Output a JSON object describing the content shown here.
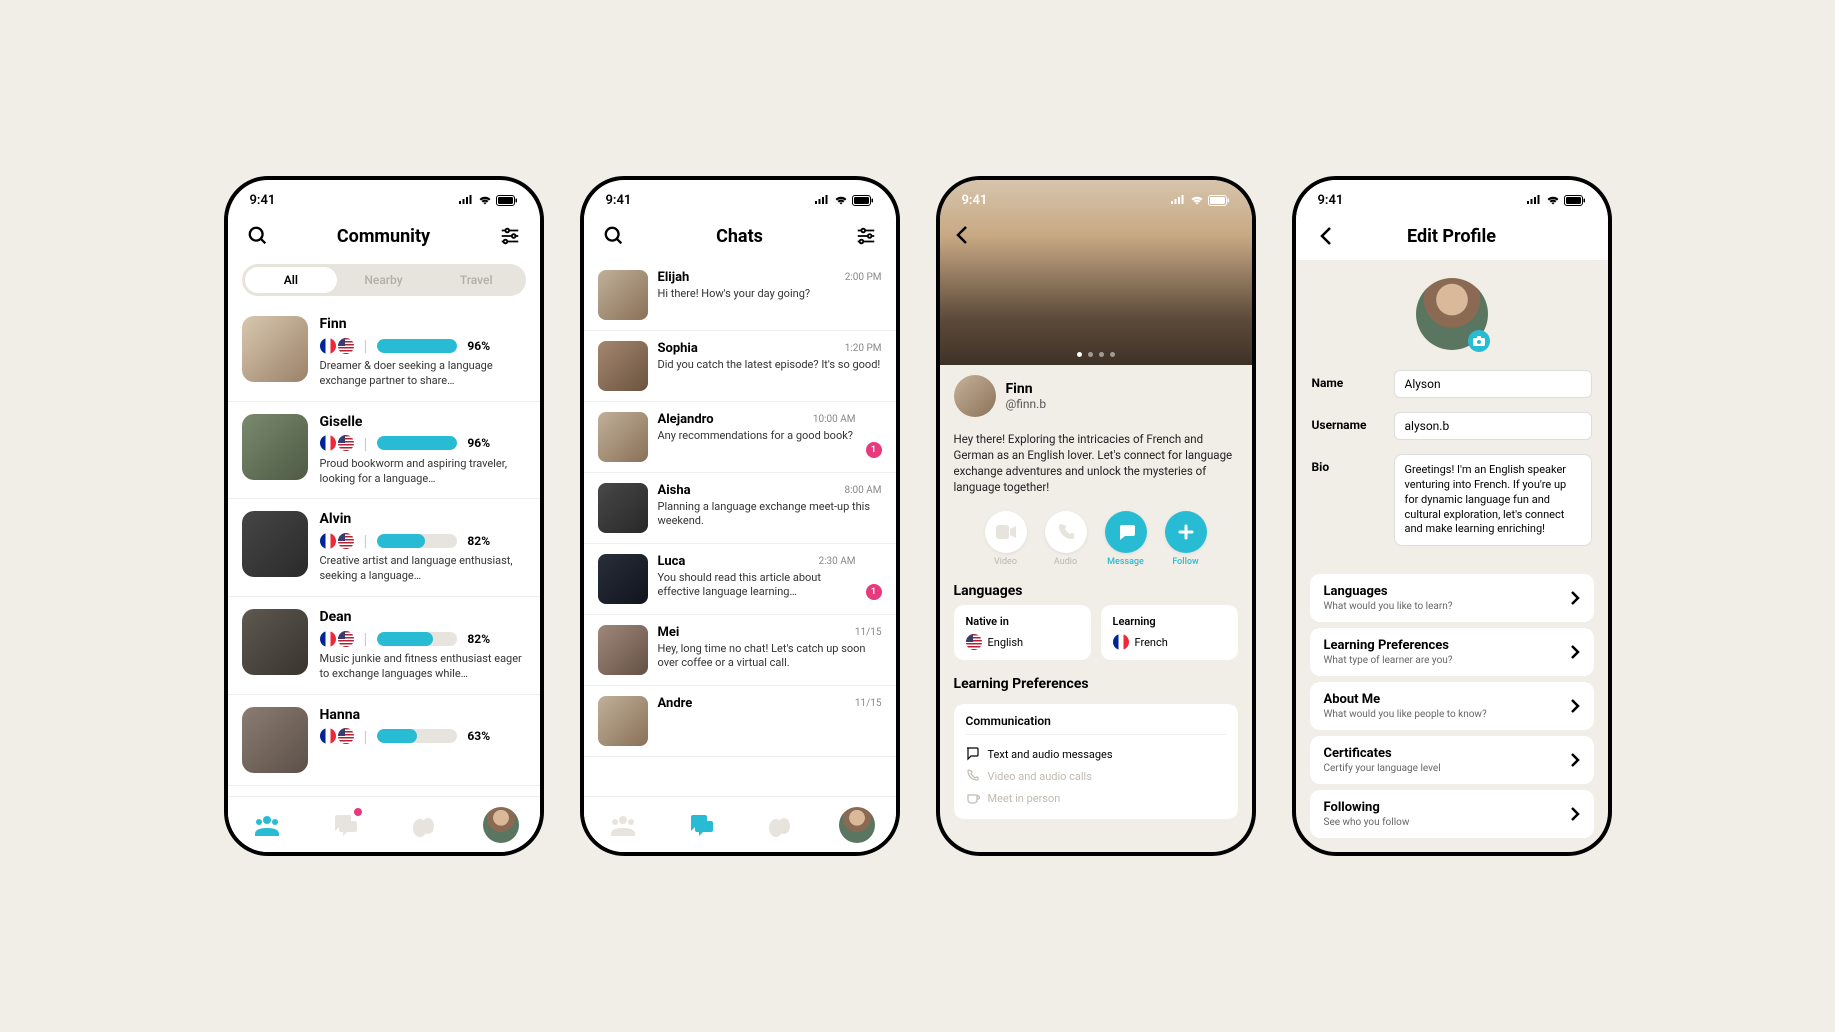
{
  "statusBar": {
    "time": "9:41"
  },
  "screen1": {
    "title": "Community",
    "tabs": [
      "All",
      "Nearby",
      "Travel"
    ],
    "activeTab": 0,
    "users": [
      {
        "name": "Finn",
        "percent": 96,
        "fill": 100,
        "bio": "Dreamer & doer seeking a language exchange partner to share…"
      },
      {
        "name": "Giselle",
        "percent": 96,
        "fill": 100,
        "bio": "Proud bookworm and aspiring traveler, looking for a language…"
      },
      {
        "name": "Alvin",
        "percent": 82,
        "fill": 60,
        "bio": "Creative artist and language enthusiast, seeking a language…"
      },
      {
        "name": "Dean",
        "percent": 82,
        "fill": 70,
        "bio": "Music junkie and fitness enthusiast eager to exchange languages while…"
      },
      {
        "name": "Hanna",
        "percent": 63,
        "fill": 50,
        "bio": ""
      }
    ]
  },
  "screen2": {
    "title": "Chats",
    "chats": [
      {
        "name": "Elijah",
        "time": "2:00 PM",
        "msg": "Hi there! How's your day going?",
        "badge": null
      },
      {
        "name": "Sophia",
        "time": "1:20 PM",
        "msg": "Did you catch the latest episode? It's so good!",
        "badge": null
      },
      {
        "name": "Alejandro",
        "time": "10:00 AM",
        "msg": "Any recommendations for a good book?",
        "badge": 1
      },
      {
        "name": "Aisha",
        "time": "8:00 AM",
        "msg": "Planning a language exchange meet-up this weekend.",
        "badge": null
      },
      {
        "name": "Luca",
        "time": "2:30 AM",
        "msg": "You should read this article about effective language learning…",
        "badge": 1
      },
      {
        "name": "Mei",
        "time": "11/15",
        "msg": "Hey, long time no chat! Let's catch up soon over coffee or a virtual call.",
        "badge": null
      },
      {
        "name": "Andre",
        "time": "11/15",
        "msg": "",
        "badge": null
      }
    ]
  },
  "screen3": {
    "name": "Finn",
    "username": "@finn.b",
    "bio": "Hey there! Exploring the intricacies of French and German as an English lover. Let's connect for language exchange adventures and unlock the mysteries of language together!",
    "actions": {
      "video": "Video",
      "audio": "Audio",
      "message": "Message",
      "follow": "Follow"
    },
    "sections": {
      "languages": "Languages",
      "native": {
        "label": "Native in",
        "lang": "English"
      },
      "learning": {
        "label": "Learning",
        "lang": "French"
      },
      "learningPrefs": "Learning Preferences",
      "communication": "Communication",
      "commItems": [
        "Text and audio messages",
        "Video and audio calls",
        "Meet in person"
      ]
    }
  },
  "screen4": {
    "title": "Edit Profile",
    "fields": {
      "nameLabel": "Name",
      "nameValue": "Alyson",
      "usernameLabel": "Username",
      "usernameValue": "alyson.b",
      "bioLabel": "Bio",
      "bioValue": "Greetings! I'm an English speaker venturing into French. If you're up for dynamic language fun and cultural exploration, let's connect and make learning enriching!"
    },
    "cards": [
      {
        "title": "Languages",
        "sub": "What would you like to learn?"
      },
      {
        "title": "Learning Preferences",
        "sub": "What type of learner are you?"
      },
      {
        "title": "About Me",
        "sub": "What would you like people to know?"
      },
      {
        "title": "Certificates",
        "sub": "Certify your language level"
      },
      {
        "title": "Following",
        "sub": "See who you follow"
      }
    ]
  }
}
